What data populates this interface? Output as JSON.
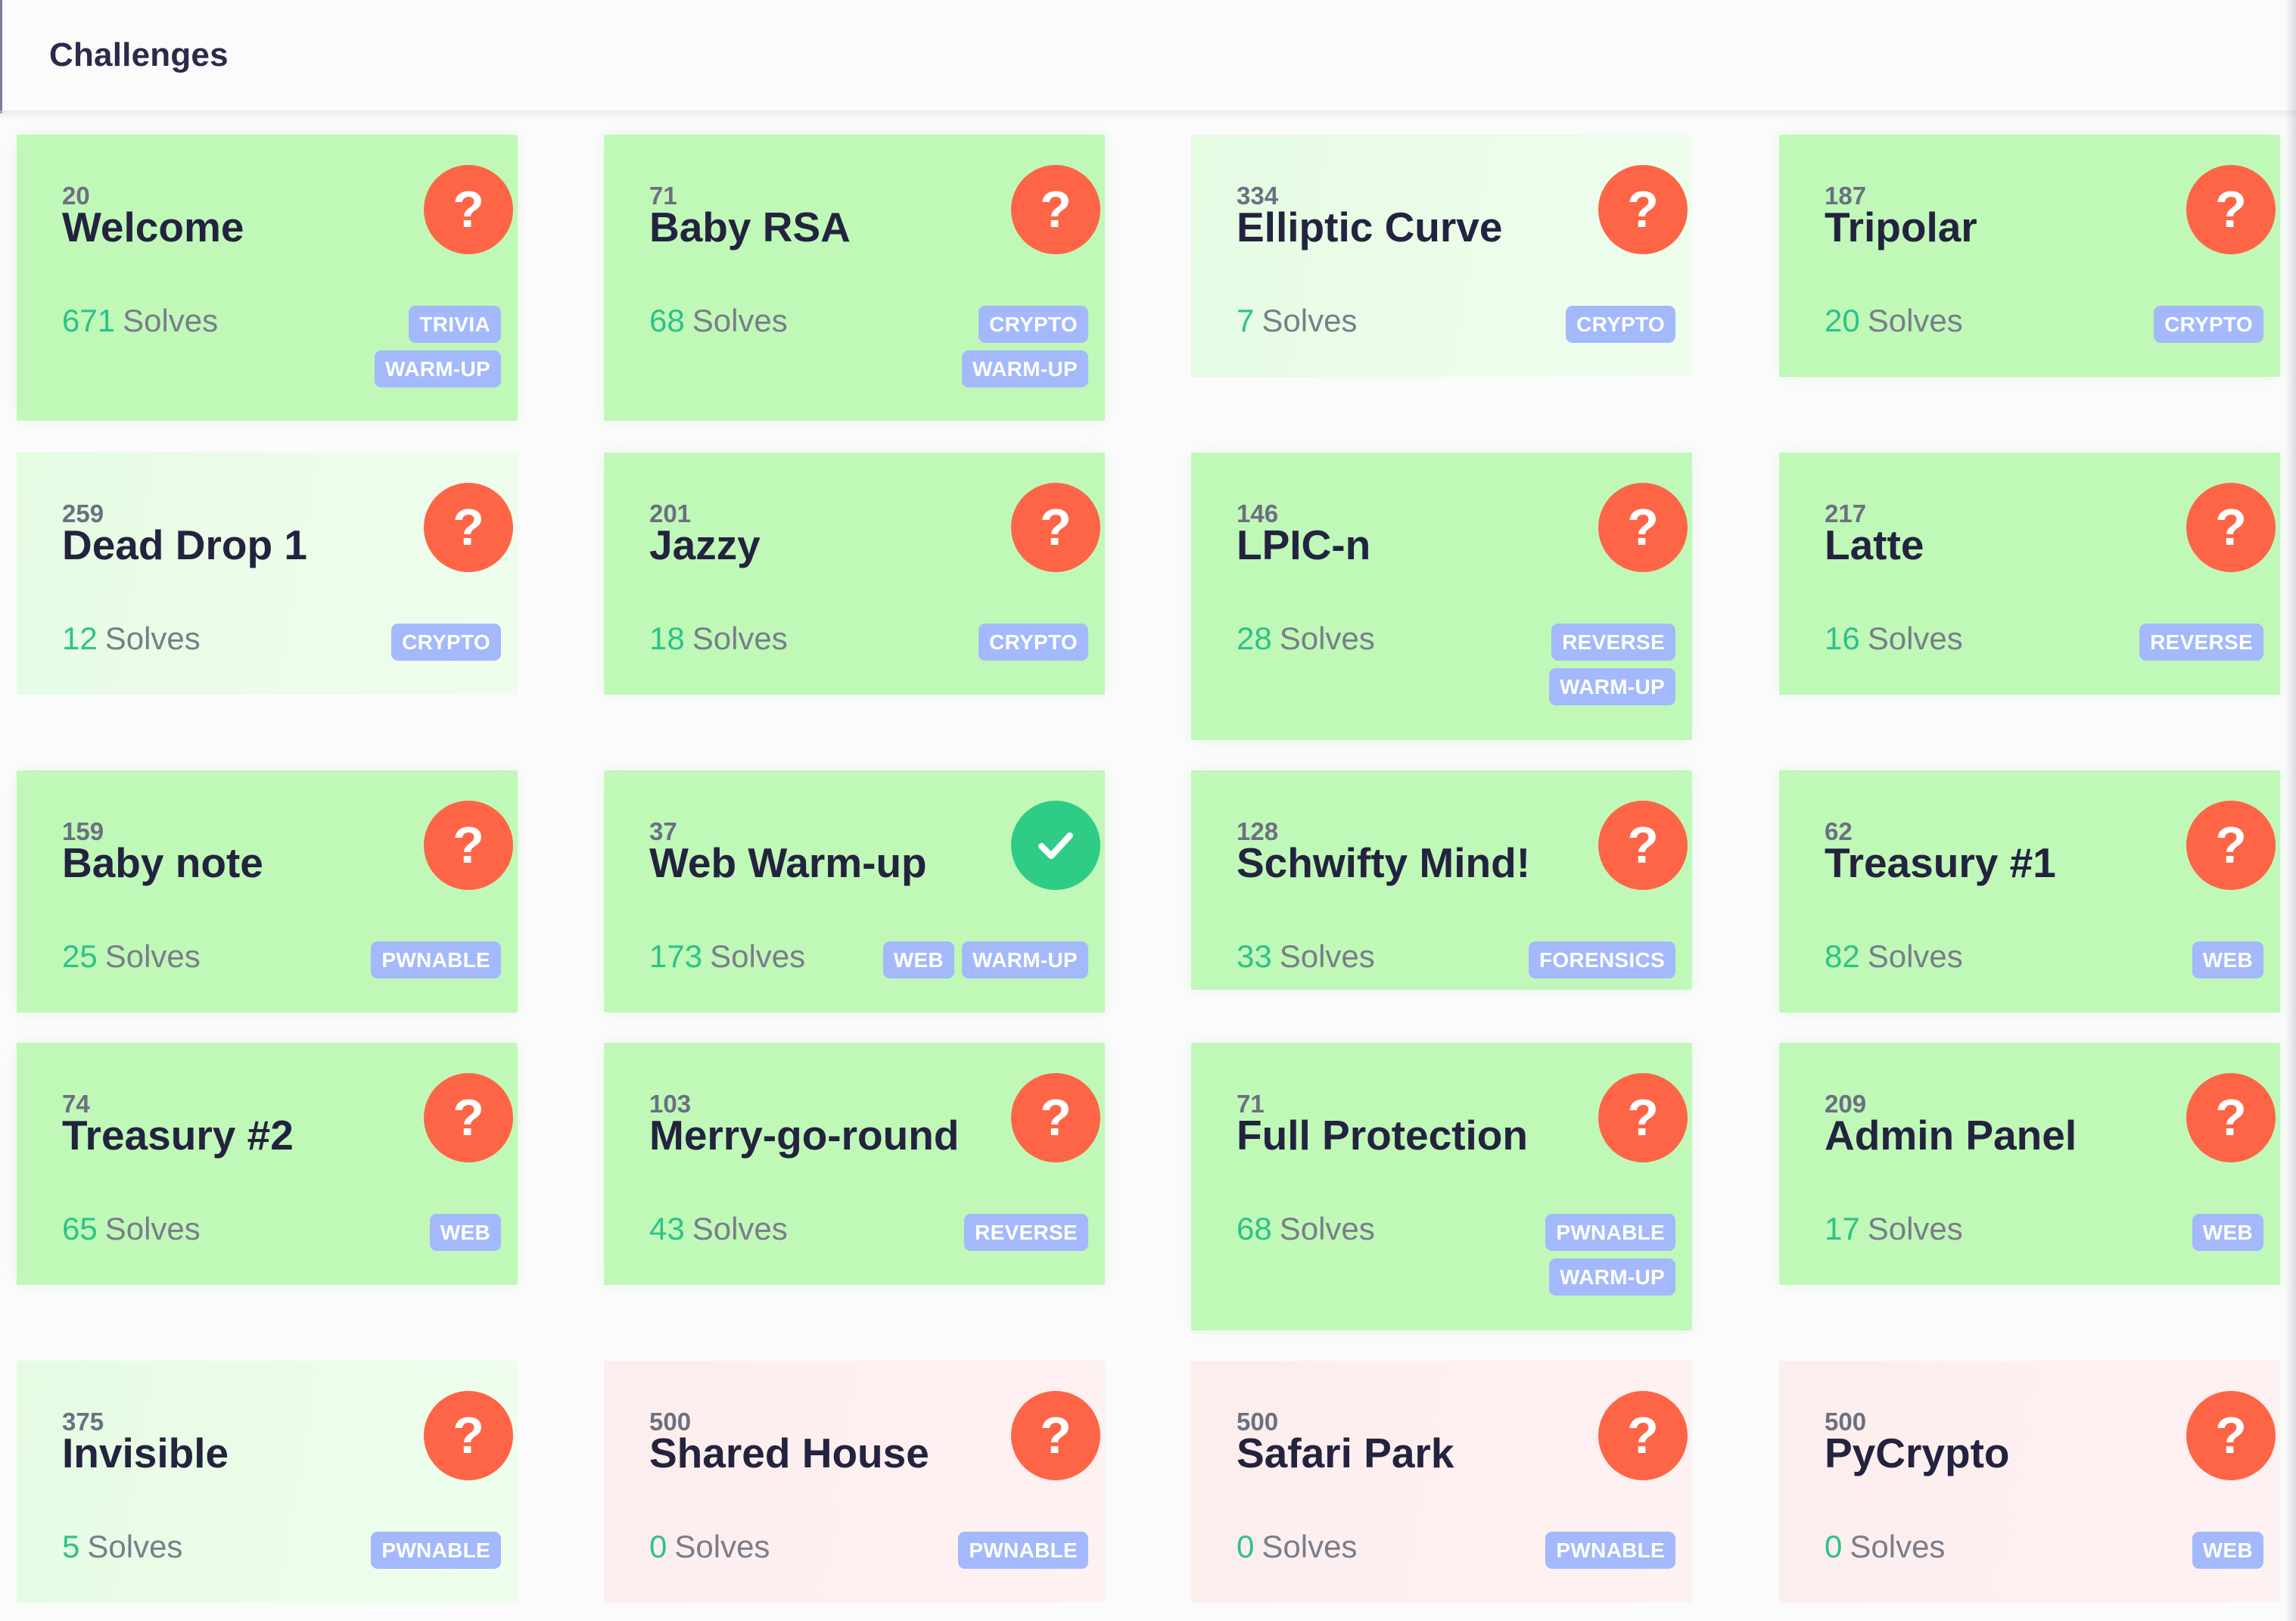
{
  "page": {
    "title": "Challenges"
  },
  "tag_color": "#a3b9fb",
  "colors": {
    "solved_many": "#c0f8b8",
    "solved_few": "#e8fbe5",
    "unsolved": "#fdeeee",
    "status_unsolved": "#fd6546",
    "status_solved": "#2fcc86",
    "solves_count": "#2cc388"
  },
  "solves_label": "Solves",
  "challenges": [
    {
      "points": "20",
      "name": "Welcome",
      "solves": "671",
      "tags": [
        [
          "TRIVIA"
        ],
        [
          "WARM-UP"
        ]
      ],
      "style": "solved-many",
      "status": "unsolved",
      "status_icon": "question-icon"
    },
    {
      "points": "71",
      "name": "Baby RSA",
      "solves": "68",
      "tags": [
        [
          "CRYPTO"
        ],
        [
          "WARM-UP"
        ]
      ],
      "style": "solved-many",
      "status": "unsolved",
      "status_icon": "question-icon"
    },
    {
      "points": "334",
      "name": "Elliptic Curve",
      "solves": "7",
      "tags": [
        [
          "CRYPTO"
        ]
      ],
      "style": "solved-few",
      "status": "unsolved",
      "status_icon": "question-icon"
    },
    {
      "points": "187",
      "name": "Tripolar",
      "solves": "20",
      "tags": [
        [
          "CRYPTO"
        ]
      ],
      "style": "solved-many",
      "status": "unsolved",
      "status_icon": "question-icon"
    },
    {
      "points": "259",
      "name": "Dead Drop 1",
      "solves": "12",
      "tags": [
        [
          "CRYPTO"
        ]
      ],
      "style": "solved-few",
      "status": "unsolved",
      "status_icon": "question-icon"
    },
    {
      "points": "201",
      "name": "Jazzy",
      "solves": "18",
      "tags": [
        [
          "CRYPTO"
        ]
      ],
      "style": "solved-many",
      "status": "unsolved",
      "status_icon": "question-icon"
    },
    {
      "points": "146",
      "name": "LPIC-n",
      "solves": "28",
      "tags": [
        [
          "REVERSE"
        ],
        [
          "WARM-UP"
        ]
      ],
      "style": "solved-many",
      "status": "unsolved",
      "status_icon": "question-icon"
    },
    {
      "points": "217",
      "name": "Latte",
      "solves": "16",
      "tags": [
        [
          "REVERSE"
        ]
      ],
      "style": "solved-many",
      "status": "unsolved",
      "status_icon": "question-icon"
    },
    {
      "points": "159",
      "name": "Baby note",
      "solves": "25",
      "tags": [
        [
          "PWNABLE"
        ]
      ],
      "style": "solved-many",
      "status": "unsolved",
      "status_icon": "question-icon"
    },
    {
      "points": "37",
      "name": "Web Warm-up",
      "solves": "173",
      "tags": [
        [
          "WEB",
          "WARM-UP"
        ]
      ],
      "style": "solved-many",
      "status": "solved",
      "status_icon": "check-icon"
    },
    {
      "points": "128",
      "name": "Schwifty Mind!",
      "solves": "33",
      "tags": [
        [
          "FORENSICS"
        ]
      ],
      "style": "solved-many",
      "status": "unsolved",
      "status_icon": "question-icon"
    },
    {
      "points": "62",
      "name": "Treasury #1",
      "solves": "82",
      "tags": [
        [
          "WEB"
        ]
      ],
      "style": "solved-many",
      "status": "unsolved",
      "status_icon": "question-icon"
    },
    {
      "points": "74",
      "name": "Treasury #2",
      "solves": "65",
      "tags": [
        [
          "WEB"
        ]
      ],
      "style": "solved-many",
      "status": "unsolved",
      "status_icon": "question-icon"
    },
    {
      "points": "103",
      "name": "Merry-go-round",
      "solves": "43",
      "tags": [
        [
          "REVERSE"
        ]
      ],
      "style": "solved-many",
      "status": "unsolved",
      "status_icon": "question-icon"
    },
    {
      "points": "71",
      "name": "Full Protection",
      "solves": "68",
      "tags": [
        [
          "PWNABLE"
        ],
        [
          "WARM-UP"
        ]
      ],
      "style": "solved-many",
      "status": "unsolved",
      "status_icon": "question-icon"
    },
    {
      "points": "209",
      "name": "Admin Panel",
      "solves": "17",
      "tags": [
        [
          "WEB"
        ]
      ],
      "style": "solved-many",
      "status": "unsolved",
      "status_icon": "question-icon"
    },
    {
      "points": "375",
      "name": "Invisible",
      "solves": "5",
      "tags": [
        [
          "PWNABLE"
        ]
      ],
      "style": "solved-few",
      "status": "unsolved",
      "status_icon": "question-icon"
    },
    {
      "points": "500",
      "name": "Shared House",
      "solves": "0",
      "tags": [
        [
          "PWNABLE"
        ]
      ],
      "style": "unsolved",
      "status": "unsolved",
      "status_icon": "question-icon"
    },
    {
      "points": "500",
      "name": "Safari Park",
      "solves": "0",
      "tags": [
        [
          "PWNABLE"
        ]
      ],
      "style": "unsolved",
      "status": "unsolved",
      "status_icon": "question-icon"
    },
    {
      "points": "500",
      "name": "PyCrypto",
      "solves": "0",
      "tags": [
        [
          "WEB"
        ]
      ],
      "style": "unsolved",
      "status": "unsolved",
      "status_icon": "question-icon"
    }
  ]
}
